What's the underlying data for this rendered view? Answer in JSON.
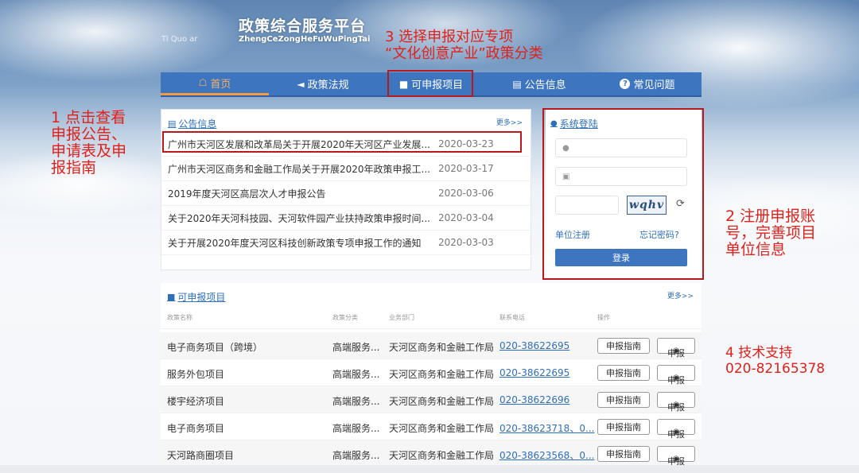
{
  "header": {
    "title": "政策综合服务平台",
    "pinyin": "ZhengCeZongHeFuWuPingTai",
    "left_text": "Ti   Quo   ar"
  },
  "nav": [
    {
      "label": "首页",
      "icon": "home-icon",
      "glyph": "🏠"
    },
    {
      "label": "政策法规",
      "icon": "megaphone-icon",
      "glyph": "🔈"
    },
    {
      "label": "可申报项目",
      "icon": "folder-icon",
      "glyph": "▆"
    },
    {
      "label": "公告信息",
      "icon": "document-icon",
      "glyph": "🗎"
    },
    {
      "label": "常见问题",
      "icon": "question-icon",
      "glyph": "?"
    }
  ],
  "notice": {
    "title": "公告信息",
    "more": "更多>>",
    "items": [
      {
        "title": "广州市天河区发展和改革局关于开展2020年天河区产业发展...",
        "date": "2020-03-23"
      },
      {
        "title": "广州市天河区商务和金融工作局关于开展2020年政策申报工...",
        "date": "2020-03-17"
      },
      {
        "title": "2019年度天河区高层次人才申报公告",
        "date": "2020-03-06"
      },
      {
        "title": "关于2020年天河科技园、天河软件园产业扶持政策申报时间...",
        "date": "2020-03-04"
      },
      {
        "title": "关于开展2020年度天河区科技创新政策专项申报工作的通知",
        "date": "2020-03-03"
      }
    ]
  },
  "login": {
    "title": "系统登陆",
    "captcha": "wqhv",
    "register": "单位注册",
    "forgot": "忘记密码?",
    "submit": "登录"
  },
  "projects": {
    "title": "可申报项目",
    "more": "更多>>",
    "columns": {
      "name": "政策名称",
      "category": "政策分类",
      "dept": "业务部门",
      "phone": "联系电话",
      "action": "操作"
    },
    "guide_label": "申报指南",
    "apply_label": "申报",
    "rows": [
      {
        "name": "电子商务项目（跨境）",
        "category": "高端服务...",
        "dept": "天河区商务和金融工作局",
        "phone": "020-38622695"
      },
      {
        "name": "服务外包项目",
        "category": "高端服务...",
        "dept": "天河区商务和金融工作局",
        "phone": "020-38622695"
      },
      {
        "name": "楼宇经济项目",
        "category": "高端服务...",
        "dept": "天河区商务和金融工作局",
        "phone": "020-38622696"
      },
      {
        "name": "电子商务项目",
        "category": "高端服务...",
        "dept": "天河区商务和金融工作局",
        "phone": "020-38623718、0..."
      },
      {
        "name": "天河路商圈项目",
        "category": "高端服务...",
        "dept": "天河区商务和金融工作局",
        "phone": "020-38623568、0..."
      }
    ]
  },
  "annotations": {
    "a1": "1 点击查看\n申报公告、\n申请表及申\n报指南",
    "a2": "2 注册申报账\n号，完善项目\n单位信息",
    "a3": "3 选择申报对应专项\n“文化创意产业”政策分类",
    "a4": "4 技术支持\n020-82165378"
  },
  "colors": {
    "nav": "#3d75bf",
    "annotation": "#e0211b",
    "link": "#2f6fb8"
  }
}
